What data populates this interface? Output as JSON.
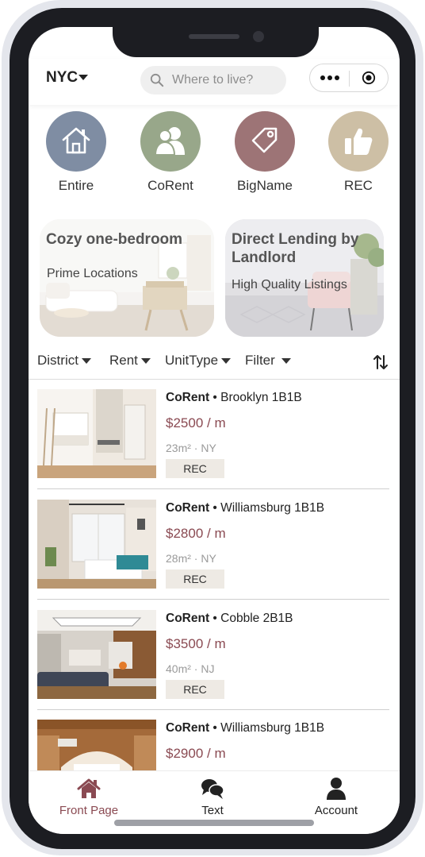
{
  "topbar": {
    "city": "NYC",
    "search_placeholder": "Where to live?"
  },
  "categories": [
    {
      "label": "Entire",
      "icon": "house-icon",
      "color": "#7f8da3"
    },
    {
      "label": "CoRent",
      "icon": "people-icon",
      "color": "#98a78a"
    },
    {
      "label": "BigName",
      "icon": "tag-icon",
      "color": "#9d7476"
    },
    {
      "label": "REC",
      "icon": "thumbs-up-icon",
      "color": "#cdbfa5"
    }
  ],
  "banners": [
    {
      "title": "Cozy one-bedroom",
      "subtitle": "Prime Locations"
    },
    {
      "title": "Direct Lending by Landlord",
      "subtitle": "High Quality Listings"
    }
  ],
  "filters": [
    "District",
    "Rent",
    "UnitType",
    "Filter"
  ],
  "listings": [
    {
      "brand": "CoRent",
      "name": "Brooklyn 1B1B",
      "price": "$2500 / m",
      "meta": "23m² · NY",
      "tag": "REC"
    },
    {
      "brand": "CoRent",
      "name": "Williamsburg 1B1B",
      "price": "$2800 / m",
      "meta": "28m² · NY",
      "tag": "REC"
    },
    {
      "brand": "CoRent",
      "name": "Cobble 2B1B",
      "price": "$3500 / m",
      "meta": "40m² · NJ",
      "tag": "REC"
    },
    {
      "brand": "CoRent",
      "name": "Williamsburg 1B1B",
      "price": "$2900 / m",
      "meta": "",
      "tag": ""
    }
  ],
  "bottom_tabs": [
    {
      "label": "Front Page",
      "icon": "home-icon",
      "active": true,
      "color": "#8a4a52"
    },
    {
      "label": "Text",
      "icon": "chat-icon",
      "active": false,
      "color": "#222222"
    },
    {
      "label": "Account",
      "icon": "person-icon",
      "active": false,
      "color": "#222222"
    }
  ]
}
